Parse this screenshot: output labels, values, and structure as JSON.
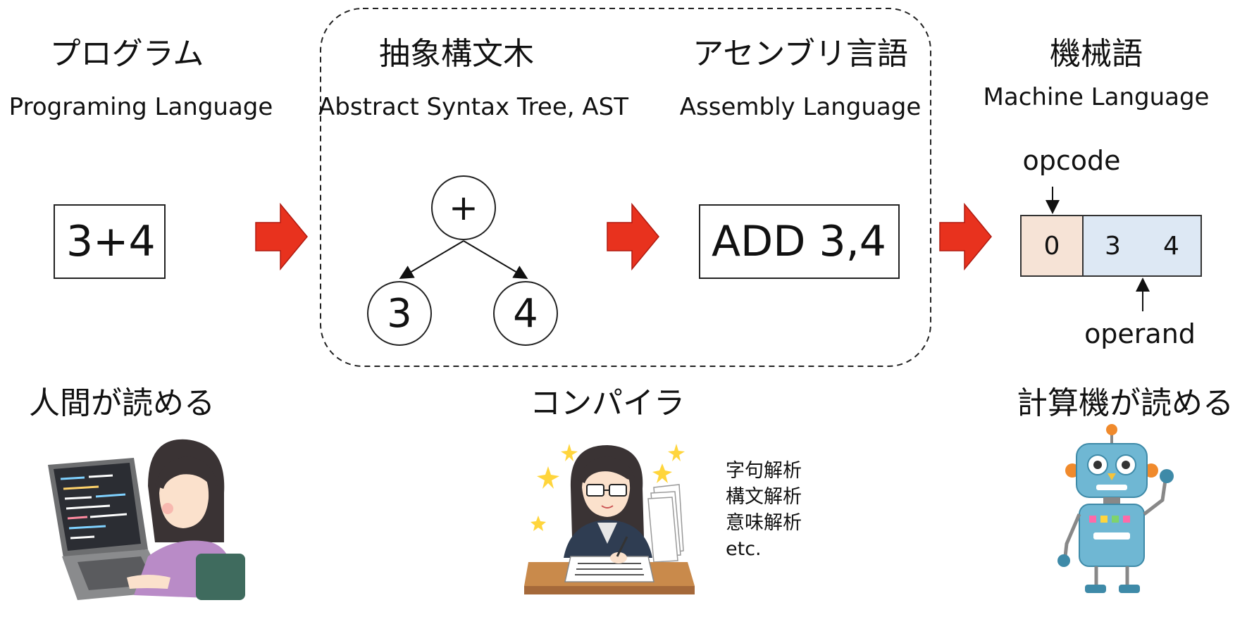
{
  "stages": {
    "program": {
      "title_jp": "プログラム",
      "title_en": "Programing Language",
      "box_text": "3+4"
    },
    "ast": {
      "title_jp": "抽象構文木",
      "title_en": "Abstract Syntax Tree, AST",
      "root": "+",
      "left": "3",
      "right": "4"
    },
    "assembly": {
      "title_jp": "アセンブリ言語",
      "title_en": "Assembly Language",
      "box_text": "ADD 3,4"
    },
    "machine": {
      "title_jp": "機械語",
      "title_en": "Machine Language",
      "opcode_label": "opcode",
      "operand_label": "operand",
      "opcode_value": "0",
      "operand_values": [
        "3",
        "4"
      ]
    }
  },
  "captions": {
    "human": "人間が読める",
    "compiler": "コンパイラ",
    "computer": "計算機が読める"
  },
  "compiler_steps": [
    "字句解析",
    "構文解析",
    "意味解析",
    "etc."
  ],
  "colors": {
    "arrow": "#e8321e",
    "opcode_fill": "#f6e3d6",
    "operand_fill": "#dde8f4",
    "dashed_border": "#222222"
  },
  "illustrations": [
    "programmer-woman-at-laptop",
    "woman-writing-with-papers",
    "robot-waving"
  ]
}
